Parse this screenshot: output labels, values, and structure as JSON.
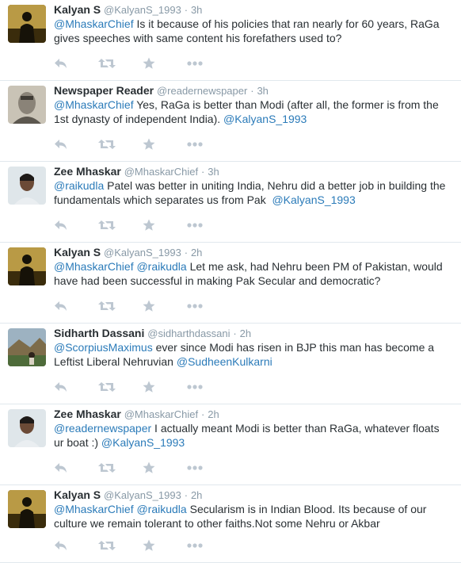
{
  "tweets": [
    {
      "name": "Kalyan S",
      "handle": "@KalyanS_1993",
      "sep": "·",
      "time": "3h",
      "avatar": "silhouette",
      "lines": [
        [
          {
            "m": true,
            "t": "@MhaskarChief"
          },
          {
            "m": false,
            "t": " Is it because of his policies that ran nearly for 60 years, RaGa"
          }
        ],
        [
          {
            "m": false,
            "t": "gives speeches with same content his forefathers used to?"
          }
        ]
      ]
    },
    {
      "name": "Newspaper Reader",
      "handle": "@readernewspaper",
      "sep": "·",
      "time": "3h",
      "avatar": "sketch",
      "lines": [
        [
          {
            "m": true,
            "t": "@MhaskarChief"
          },
          {
            "m": false,
            "t": " Yes, RaGa is better than Modi (after all, the former is from the"
          }
        ],
        [
          {
            "m": false,
            "t": "1st dynasty of independent India). "
          },
          {
            "m": true,
            "t": "@KalyanS_1993"
          }
        ]
      ]
    },
    {
      "name": "Zee Mhaskar",
      "handle": "@MhaskarChief",
      "sep": "·",
      "time": "3h",
      "avatar": "photo",
      "lines": [
        [
          {
            "m": true,
            "t": "@raikudla"
          },
          {
            "m": false,
            "t": " Patel was better in uniting India, Nehru did a better job in building the"
          }
        ],
        [
          {
            "m": false,
            "t": "fundamentals which separates us from Pak  "
          },
          {
            "m": true,
            "t": "@KalyanS_1993"
          }
        ]
      ]
    },
    {
      "name": "Kalyan S",
      "handle": "@KalyanS_1993",
      "sep": "·",
      "time": "2h",
      "avatar": "silhouette",
      "lines": [
        [
          {
            "m": true,
            "t": "@MhaskarChief"
          },
          {
            "m": false,
            "t": " "
          },
          {
            "m": true,
            "t": "@raikudla"
          },
          {
            "m": false,
            "t": " Let me ask, had Nehru been PM of Pakistan, would"
          }
        ],
        [
          {
            "m": false,
            "t": "have had been successful in making Pak Secular and democratic?"
          }
        ]
      ]
    },
    {
      "name": "Sidharth Dassani",
      "handle": "@sidharthdassani",
      "sep": "·",
      "time": "2h",
      "avatar": "landscape",
      "lines": [
        [
          {
            "m": true,
            "t": "@ScorpiusMaximus"
          },
          {
            "m": false,
            "t": " ever since Modi has risen in BJP this man has become a"
          }
        ],
        [
          {
            "m": false,
            "t": "Leftist Liberal Nehruvian "
          },
          {
            "m": true,
            "t": "@SudheenKulkarni"
          }
        ]
      ]
    },
    {
      "name": "Zee Mhaskar",
      "handle": "@MhaskarChief",
      "sep": "·",
      "time": "2h",
      "avatar": "photo",
      "lines": [
        [
          {
            "m": true,
            "t": "@readernewspaper"
          },
          {
            "m": false,
            "t": " I actually meant Modi is better than RaGa, whatever floats"
          }
        ],
        [
          {
            "m": false,
            "t": "ur boat :) "
          },
          {
            "m": true,
            "t": "@KalyanS_1993"
          }
        ]
      ]
    },
    {
      "name": "Kalyan S",
      "handle": "@KalyanS_1993",
      "sep": "·",
      "time": "2h",
      "avatar": "silhouette",
      "lines": [
        [
          {
            "m": true,
            "t": "@MhaskarChief"
          },
          {
            "m": false,
            "t": " "
          },
          {
            "m": true,
            "t": "@raikudla"
          },
          {
            "m": false,
            "t": " Secularism is in Indian Blood. Its because of our"
          }
        ],
        [
          {
            "m": false,
            "t": "culture we remain tolerant to other faiths.Not some Nehru or Akbar"
          }
        ]
      ]
    }
  ],
  "actions": [
    "reply-icon",
    "retweet-icon",
    "favorite-icon",
    "more-icon"
  ],
  "colors": {
    "name": "#292f33",
    "meta": "#8899a6",
    "mention": "#2b7bb9",
    "icon": "#bdc7d1",
    "divider": "#e1e8ed"
  }
}
